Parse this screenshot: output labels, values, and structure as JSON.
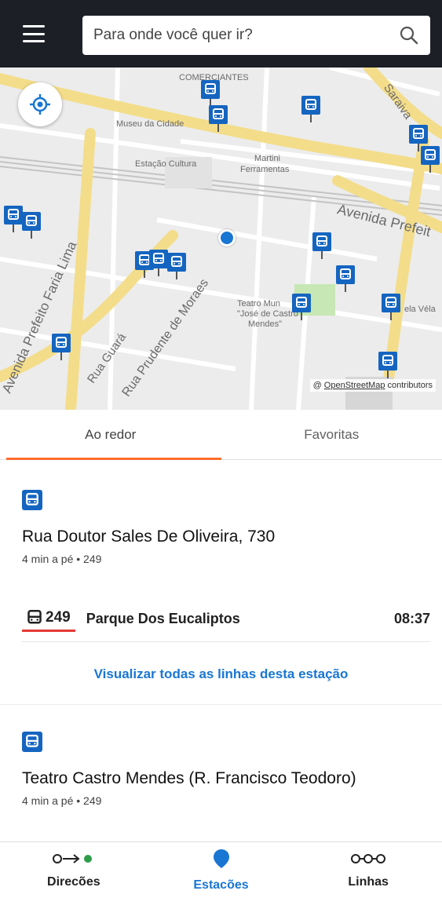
{
  "search": {
    "placeholder": "Para onde você quer ir?"
  },
  "map": {
    "labels": {
      "museu": "Museu da Cidade",
      "estacao": "Estação Cultura",
      "martini": "Martini",
      "ferramentas": "Ferramentas",
      "comerciantes": "COMERCIANTES",
      "teatro1": "Teatro Mun",
      "teatro2": "\"José de Castro",
      "teatro3": "Mendes\"",
      "vela": "ela Véla"
    },
    "streets": {
      "avenida_prefeito": "Avenida Prefeit",
      "faria_lima": "Avenida Prefeito Faria Lima",
      "prudente": "Rua Prudente de Moraes",
      "guara": "Rua Guará",
      "saraiva": "Saraiva"
    },
    "attribution_prefix": "@",
    "attribution_link": "OpenStreetMap",
    "attribution_suffix": "contributors"
  },
  "tabs": [
    {
      "label": "Ao redor"
    },
    {
      "label": "Favoritas"
    }
  ],
  "stations": [
    {
      "name": "Rua Doutor Sales De Oliveira, 730",
      "meta": "4 min a pé • 249"
    },
    {
      "name": "Teatro Castro Mendes (R. Francisco Teodoro)",
      "meta": "4 min a pé • 249"
    }
  ],
  "line": {
    "number": "249",
    "destination": "Parque Dos Eucaliptos",
    "time": "08:37"
  },
  "view_all": "Visualizar todas as linhas desta estação",
  "nav": [
    {
      "label": "Direcões"
    },
    {
      "label": "Estacões"
    },
    {
      "label": "Linhas"
    }
  ],
  "colors": {
    "accent_blue": "#1976d2",
    "pin_blue": "#1565c0",
    "tab_indicator": "#ff6d2d",
    "line_underline": "#e53935",
    "topbar": "#1c1f26"
  }
}
